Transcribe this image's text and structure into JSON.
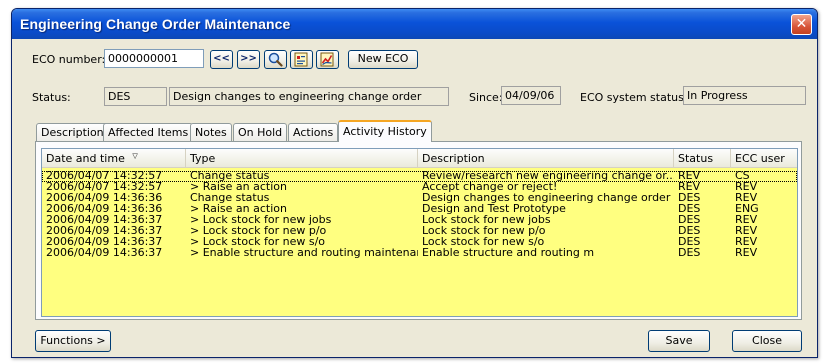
{
  "window": {
    "title": "Engineering Change Order Maintenance"
  },
  "eco": {
    "number_label": "ECO number:",
    "number_value": "0000000001",
    "prev_label": "<<",
    "next_label": ">>",
    "new_eco_label": "New ECO",
    "icons": [
      "search-icon",
      "edit-document-icon",
      "chart-icon"
    ]
  },
  "status": {
    "label": "Status:",
    "code": "DES",
    "description": "Design changes to engineering change order",
    "since_label": "Since:",
    "since_value": "04/09/06",
    "system_status_label": "ECO system status:",
    "system_status_value": "In Progress"
  },
  "tabs": [
    {
      "label": "Description"
    },
    {
      "label": "Affected Items"
    },
    {
      "label": "Notes"
    },
    {
      "label": "On Hold"
    },
    {
      "label": "Actions"
    },
    {
      "label": "Activity History",
      "active": true
    }
  ],
  "grid": {
    "columns": [
      "Date and time",
      "Type",
      "Description",
      "Status",
      "ECC user"
    ],
    "sort_indicator": "▽",
    "rows": [
      {
        "date": "2006/04/07 14:32:57",
        "type": "Change status",
        "description": "Review/research new engineering change or...",
        "status": "REV",
        "user": "CS",
        "selected": true
      },
      {
        "date": "2006/04/07 14:32:57",
        "type": "> Raise an action",
        "description": "Accept change or reject!",
        "status": "REV",
        "user": "REV"
      },
      {
        "date": "2006/04/09 14:36:36",
        "type": "Change status",
        "description": "Design changes to engineering change order",
        "status": "DES",
        "user": "REV"
      },
      {
        "date": "2006/04/09 14:36:36",
        "type": "> Raise an action",
        "description": "Design and Test Prototype",
        "status": "DES",
        "user": "ENG"
      },
      {
        "date": "2006/04/09 14:36:37",
        "type": "> Lock stock for new jobs",
        "description": "Lock stock for new jobs",
        "status": "DES",
        "user": "REV"
      },
      {
        "date": "2006/04/09 14:36:37",
        "type": "> Lock stock for new p/o",
        "description": "Lock stock for new p/o",
        "status": "DES",
        "user": "REV"
      },
      {
        "date": "2006/04/09 14:36:37",
        "type": "> Lock stock for new s/o",
        "description": "Lock stock for new s/o",
        "status": "DES",
        "user": "REV"
      },
      {
        "date": "2006/04/09 14:36:37",
        "type": "> Enable structure and routing maintenance",
        "description": "Enable structure and routing m",
        "status": "DES",
        "user": "REV"
      }
    ]
  },
  "footer": {
    "functions_label": "Functions >",
    "save_label": "Save",
    "close_label": "Close"
  },
  "colors": {
    "titlebar": "#0a52d9",
    "window_bg": "#ece9d8",
    "grid_bg": "#ffff80",
    "active_tab_accent": "#f5a623",
    "close_button": "#d8563a"
  }
}
